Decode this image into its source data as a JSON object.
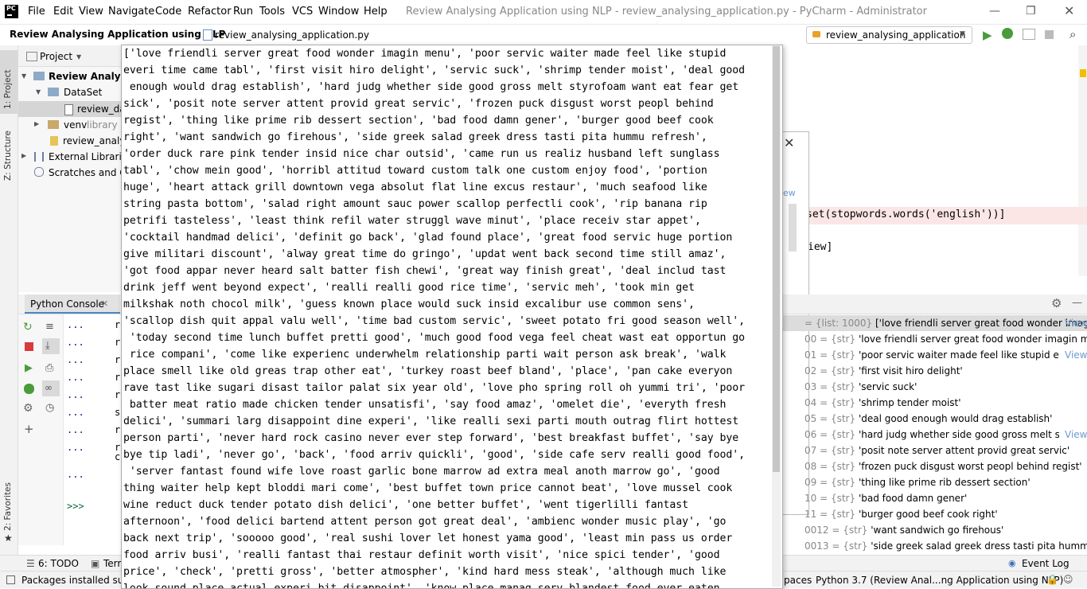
{
  "window": {
    "title": "Review Analysing Application using NLP - review_analysing_application.py - PyCharm - Administrator",
    "menu": [
      "File",
      "Edit",
      "View",
      "Navigate",
      "Code",
      "Refactor",
      "Run",
      "Tools",
      "VCS",
      "Window",
      "Help"
    ],
    "logo_text": "PC"
  },
  "navbar": {
    "project": "Review Analysing Application using NLP",
    "file": "review_analysing_application.py",
    "run_config": "review_analysing_application"
  },
  "left_stripe": {
    "project_tab": "1: Project",
    "structure_tab": "Z: Structure",
    "favorites_tab": "2: Favorites"
  },
  "project_panel": {
    "header": "Project",
    "items": [
      {
        "label": "Review Analysi"
      },
      {
        "label": "DataSet"
      },
      {
        "label": "review_data"
      },
      {
        "label": "venv",
        "hint": "library ro"
      },
      {
        "label": "review_analy"
      },
      {
        "label": "External Libraries"
      },
      {
        "label": "Scratches and Co"
      }
    ]
  },
  "console": {
    "tab_label": "Python Console",
    "prompt_dots": [
      "...",
      "...",
      "...",
      "...",
      "...",
      "...",
      "...",
      "...",
      "..."
    ],
    "side_letters": [
      "r",
      "r",
      "r",
      "r",
      "r",
      "s",
      "r",
      "r",
      "c"
    ],
    "prompt": ">>>"
  },
  "editor_right": {
    "code_line1": "set(stopwords.words('english'))]",
    "code_line1_str": "'english'",
    "code_line2": "iew]",
    "dialog_frag": "ew"
  },
  "popup_lines": [
    "['love friendli server great food wonder imagin menu', 'poor servic waiter made feel like stupid",
    "everi time came tabl', 'first visit hiro delight', 'servic suck', 'shrimp tender moist', 'deal good",
    " enough would drag establish', 'hard judg whether side good gross melt styrofoam want eat fear get",
    "sick', 'posit note server attent provid great servic', 'frozen puck disgust worst peopl behind",
    "regist', 'thing like prime rib dessert section', 'bad food damn gener', 'burger good beef cook",
    "right', 'want sandwich go firehous', 'side greek salad greek dress tasti pita hummu refresh',",
    "'order duck rare pink tender insid nice char outsid', 'came run us realiz husband left sunglass",
    "tabl', 'chow mein good', 'horribl attitud toward custom talk one custom enjoy food', 'portion",
    "huge', 'heart attack grill downtown vega absolut flat line excus restaur', 'much seafood like",
    "string pasta bottom', 'salad right amount sauc power scallop perfectli cook', 'rip banana rip",
    "petrifi tasteless', 'least think refil water struggl wave minut', 'place receiv star appet',",
    "'cocktail handmad delici', 'definit go back', 'glad found place', 'great food servic huge portion",
    "give militari discount', 'alway great time do gringo', 'updat went back second time still amaz',",
    "'got food appar never heard salt batter fish chewi', 'great way finish great', 'deal includ tast",
    "drink jeff went beyond expect', 'realli realli good rice time', 'servic meh', 'took min get",
    "milkshak noth chocol milk', 'guess known place would suck insid excalibur use common sens',",
    "'scallop dish quit appal valu well', 'time bad custom servic', 'sweet potato fri good season well',",
    " 'today second time lunch buffet pretti good', 'much good food vega feel cheat wast eat opportun go",
    " rice compani', 'come like experienc underwhelm relationship parti wait person ask break', 'walk",
    "place smell like old greas trap other eat', 'turkey roast beef bland', 'place', 'pan cake everyon",
    "rave tast like sugari disast tailor palat six year old', 'love pho spring roll oh yummi tri', 'poor",
    " batter meat ratio made chicken tender unsatisfi', 'say food amaz', 'omelet die', 'everyth fresh",
    "delici', 'summari larg disappoint dine experi', 'like realli sexi parti mouth outrag flirt hottest",
    "person parti', 'never hard rock casino never ever step forward', 'best breakfast buffet', 'say bye",
    "bye tip ladi', 'never go', 'back', 'food arriv quickli', 'good', 'side cafe serv realli good food',",
    " 'server fantast found wife love roast garlic bone marrow ad extra meal anoth marrow go', 'good",
    "thing waiter help kept bloddi mari come', 'best buffet town price cannot beat', 'love mussel cook",
    "wine reduct duck tender potato dish delici', 'one better buffet', 'went tigerlilli fantast",
    "afternoon', 'food delici bartend attent person got great deal', 'ambienc wonder music play', 'go",
    "back next trip', 'sooooo good', 'real sushi lover let honest yama good', 'least min pass us order",
    "food arriv busi', 'realli fantast thai restaur definit worth visit', 'nice spici tender', 'good",
    "price', 'check', 'pretti gross', 'better atmospher', 'kind hard mess steak', 'although much like",
    "look sound place actual experi bit disappoint', 'know place manag serv blandest food ever eaten"
  ],
  "variables": {
    "view_link": "View",
    "rows": [
      {
        "prefix": "= {list: 1000}",
        "value": "['love friendli server great food wonder imagi...",
        "link": "View",
        "selected": true
      },
      {
        "prefix": "00 = {str}",
        "value": "'love friendli server great food wonder imagin menu'"
      },
      {
        "prefix": "01 = {str}",
        "value": "'poor servic waiter made feel like stupid everi time ...",
        "link": "View"
      },
      {
        "prefix": "02 = {str}",
        "value": "'first visit hiro delight'"
      },
      {
        "prefix": "03 = {str}",
        "value": "'servic suck'"
      },
      {
        "prefix": "04 = {str}",
        "value": "'shrimp tender moist'"
      },
      {
        "prefix": "05 = {str}",
        "value": "'deal good enough would drag establish'"
      },
      {
        "prefix": "06 = {str}",
        "value": "'hard judg whether side good gross melt styrofoan...",
        "link": "View"
      },
      {
        "prefix": "07 = {str}",
        "value": "'posit note server attent provid great servic'"
      },
      {
        "prefix": "08 = {str}",
        "value": "'frozen puck disgust worst peopl behind regist'"
      },
      {
        "prefix": "09 = {str}",
        "value": "'thing like prime rib dessert section'"
      },
      {
        "prefix": "10 = {str}",
        "value": "'bad food damn gener'"
      },
      {
        "prefix": "11 = {str}",
        "value": "'burger good beef cook right'"
      },
      {
        "prefix": "0012 = {str}",
        "value": "'want sandwich go firehous'"
      },
      {
        "prefix": "0013 = {str}",
        "value": "'side greek salad greek dress tasti pita hummu refresh'"
      }
    ]
  },
  "bottom_tabs": {
    "todo": "6: TODO",
    "terminal": "Terr",
    "event_log": "Event Log"
  },
  "status": {
    "left": "Packages installed succ",
    "spaces": "paces",
    "interpreter": "Python 3.7 (Review Anal...ng Application using NLP)"
  },
  "colors": {
    "accent_blue": "#3d6fb5",
    "run_green": "#4a9b3a",
    "stop_red": "#d83b3b",
    "string_green": "#067d17",
    "error_bg": "#fbe6e6"
  }
}
